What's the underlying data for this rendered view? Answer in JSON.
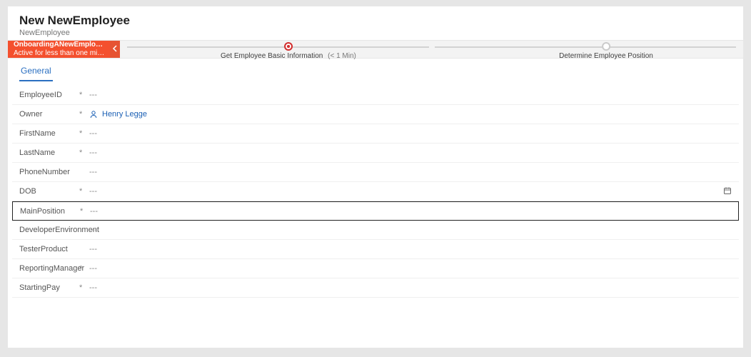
{
  "header": {
    "title": "New NewEmployee",
    "entity": "NewEmployee"
  },
  "process": {
    "name": "OnboardingANewEmplo…",
    "status": "Active for less than one mi…",
    "stages": [
      {
        "label": "Get Employee Basic Information",
        "time": "(< 1 Min)",
        "active": true
      },
      {
        "label": "Determine Employee Position",
        "time": "",
        "active": false
      }
    ]
  },
  "tabs": [
    {
      "label": "General",
      "active": true
    }
  ],
  "form": {
    "fields": [
      {
        "key": "EmployeeID",
        "label": "EmployeeID",
        "req": "*",
        "value": "---"
      },
      {
        "key": "Owner",
        "label": "Owner",
        "req": "*",
        "value": "Henry Legge",
        "type": "person"
      },
      {
        "key": "FirstName",
        "label": "FirstName",
        "req": "*",
        "value": "---"
      },
      {
        "key": "LastName",
        "label": "LastName",
        "req": "*",
        "value": "---"
      },
      {
        "key": "PhoneNumber",
        "label": "PhoneNumber",
        "req": "",
        "value": "---"
      },
      {
        "key": "DOB",
        "label": "DOB",
        "req": "*",
        "value": "---",
        "type": "date"
      },
      {
        "key": "MainPosition",
        "label": "MainPosition",
        "req": "*",
        "value": "---",
        "selected": true
      },
      {
        "key": "DeveloperEnvironment",
        "label": "DeveloperEnvironment",
        "req": "",
        "value": "---"
      },
      {
        "key": "TesterProduct",
        "label": "TesterProduct",
        "req": "",
        "value": "---"
      },
      {
        "key": "ReportingManager",
        "label": "ReportingManager",
        "req": "*",
        "value": "---"
      },
      {
        "key": "StartingPay",
        "label": "StartingPay",
        "req": "*",
        "value": "---"
      }
    ]
  }
}
